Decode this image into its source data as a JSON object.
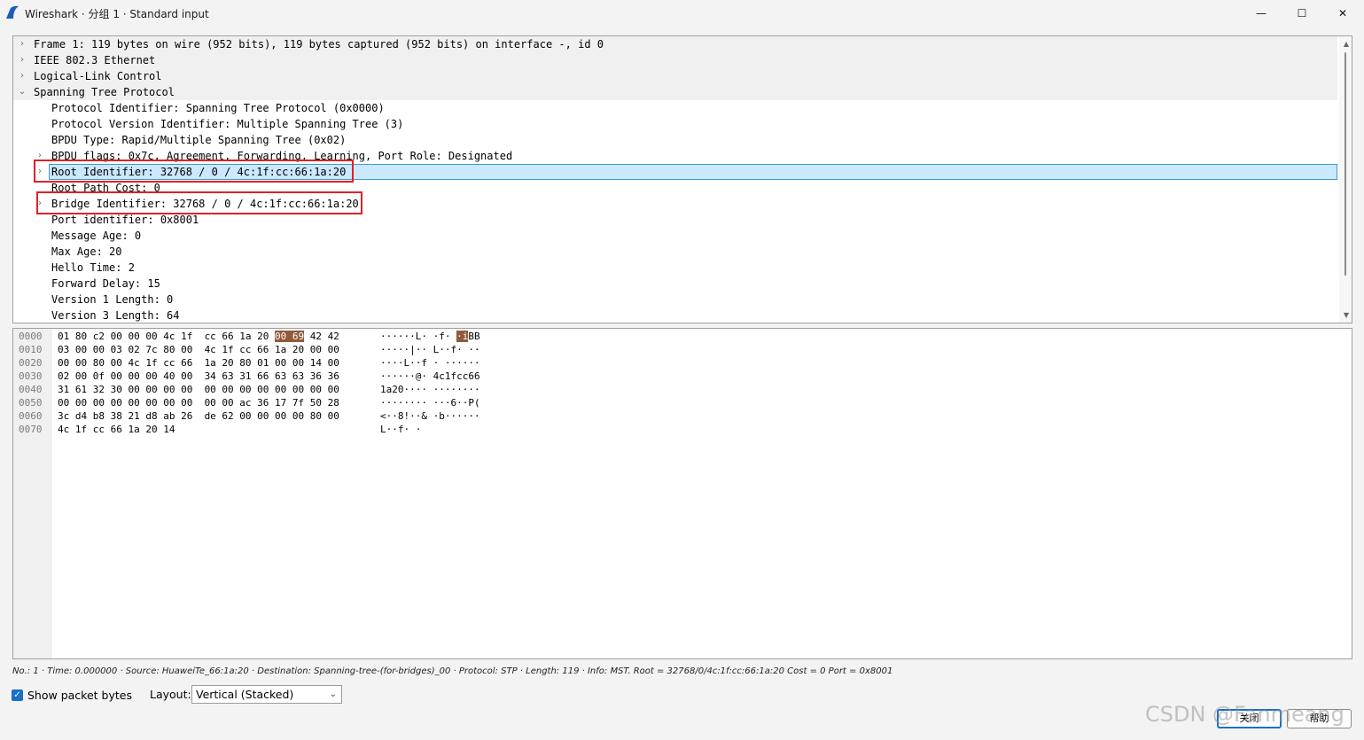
{
  "window": {
    "title": "Wireshark · 分组 1 · Standard input",
    "minimize": "—",
    "maximize": "☐",
    "close": "✕"
  },
  "tree": {
    "rows": [
      {
        "text": "Frame 1: 119 bytes on wire (952 bits), 119 bytes captured (952 bits) on interface -, id 0",
        "arrow": "›",
        "level": 0
      },
      {
        "text": "IEEE 802.3 Ethernet",
        "arrow": "›",
        "level": 0
      },
      {
        "text": "Logical-Link Control",
        "arrow": "›",
        "level": 0
      },
      {
        "text": "Spanning Tree Protocol",
        "arrow": "⌄",
        "level": 0
      },
      {
        "text": "Protocol Identifier: Spanning Tree Protocol (0x0000)",
        "arrow": "",
        "level": 1
      },
      {
        "text": "Protocol Version Identifier: Multiple Spanning Tree (3)",
        "arrow": "",
        "level": 1
      },
      {
        "text": "BPDU Type: Rapid/Multiple Spanning Tree (0x02)",
        "arrow": "",
        "level": 1
      },
      {
        "text": "BPDU flags: 0x7c, Agreement, Forwarding, Learning, Port Role: Designated",
        "arrow": "›",
        "level": 1
      },
      {
        "text": "Root Identifier: 32768 / 0 / 4c:1f:cc:66:1a:20",
        "arrow": "›",
        "level": 1,
        "selected": true
      },
      {
        "text": "Root Path Cost: 0",
        "arrow": "",
        "level": 1
      },
      {
        "text": "Bridge Identifier: 32768 / 0 / 4c:1f:cc:66:1a:20",
        "arrow": "›",
        "level": 1
      },
      {
        "text": "Port identifier: 0x8001",
        "arrow": "",
        "level": 1
      },
      {
        "text": "Message Age: 0",
        "arrow": "",
        "level": 1
      },
      {
        "text": "Max Age: 20",
        "arrow": "",
        "level": 1
      },
      {
        "text": "Hello Time: 2",
        "arrow": "",
        "level": 1
      },
      {
        "text": "Forward Delay: 15",
        "arrow": "",
        "level": 1
      },
      {
        "text": "Version 1 Length: 0",
        "arrow": "",
        "level": 1
      },
      {
        "text": "Version 3 Length: 64",
        "arrow": "",
        "level": 1
      }
    ]
  },
  "bytes": {
    "rows": [
      {
        "offset": "0000",
        "hex_a": "01 80 c2 00 00 00 4c 1f  cc 66 1a 20 ",
        "hex_hl": "00 69",
        "hex_b": " 42 42",
        "ascii_a": "······L· ·f· ",
        "ascii_hl": "·i",
        "ascii_b": "BB"
      },
      {
        "offset": "0010",
        "hex_a": "03 00 00 03 02 7c 80 00  4c 1f cc 66 1a 20 00 00",
        "hex_hl": "",
        "hex_b": "",
        "ascii_a": "·····|·· L··f· ··",
        "ascii_hl": "",
        "ascii_b": ""
      },
      {
        "offset": "0020",
        "hex_a": "00 00 80 00 4c 1f cc 66  1a 20 80 01 00 00 14 00",
        "hex_hl": "",
        "hex_b": "",
        "ascii_a": "····L··f · ······",
        "ascii_hl": "",
        "ascii_b": ""
      },
      {
        "offset": "0030",
        "hex_a": "02 00 0f 00 00 00 40 00  34 63 31 66 63 63 36 36",
        "hex_hl": "",
        "hex_b": "",
        "ascii_a": "······@· 4c1fcc66",
        "ascii_hl": "",
        "ascii_b": ""
      },
      {
        "offset": "0040",
        "hex_a": "31 61 32 30 00 00 00 00  00 00 00 00 00 00 00 00",
        "hex_hl": "",
        "hex_b": "",
        "ascii_a": "1a20···· ········",
        "ascii_hl": "",
        "ascii_b": ""
      },
      {
        "offset": "0050",
        "hex_a": "00 00 00 00 00 00 00 00  00 00 ac 36 17 7f 50 28",
        "hex_hl": "",
        "hex_b": "",
        "ascii_a": "········ ···6··P(",
        "ascii_hl": "",
        "ascii_b": ""
      },
      {
        "offset": "0060",
        "hex_a": "3c d4 b8 38 21 d8 ab 26  de 62 00 00 00 00 80 00",
        "hex_hl": "",
        "hex_b": "",
        "ascii_a": "<··8!··& ·b······",
        "ascii_hl": "",
        "ascii_b": ""
      },
      {
        "offset": "0070",
        "hex_a": "4c 1f cc 66 1a 20 14",
        "hex_hl": "",
        "hex_b": "",
        "ascii_a": "L··f· ·",
        "ascii_hl": "",
        "ascii_b": ""
      }
    ]
  },
  "status": "No.: 1 · Time: 0.000000 · Source: HuaweiTe_66:1a:20 · Destination: Spanning-tree-(for-bridges)_00 · Protocol: STP · Length: 119 · Info: MST. Root = 32768/0/4c:1f:cc:66:1a:20  Cost = 0  Port = 0x8001",
  "controls": {
    "show_bytes_label": "Show packet bytes",
    "show_bytes_checked": true,
    "layout_label": "Layout:",
    "layout_value": "Vertical (Stacked)",
    "close_button": "关闭",
    "help_button": "帮助"
  },
  "watermark": "CSDN @Fanmeang",
  "colors": {
    "selection_bg": "#cce8ff",
    "highlight_byte": "#8f5a39",
    "annotation_box": "#e0202a",
    "accent": "#1a6fc9"
  }
}
